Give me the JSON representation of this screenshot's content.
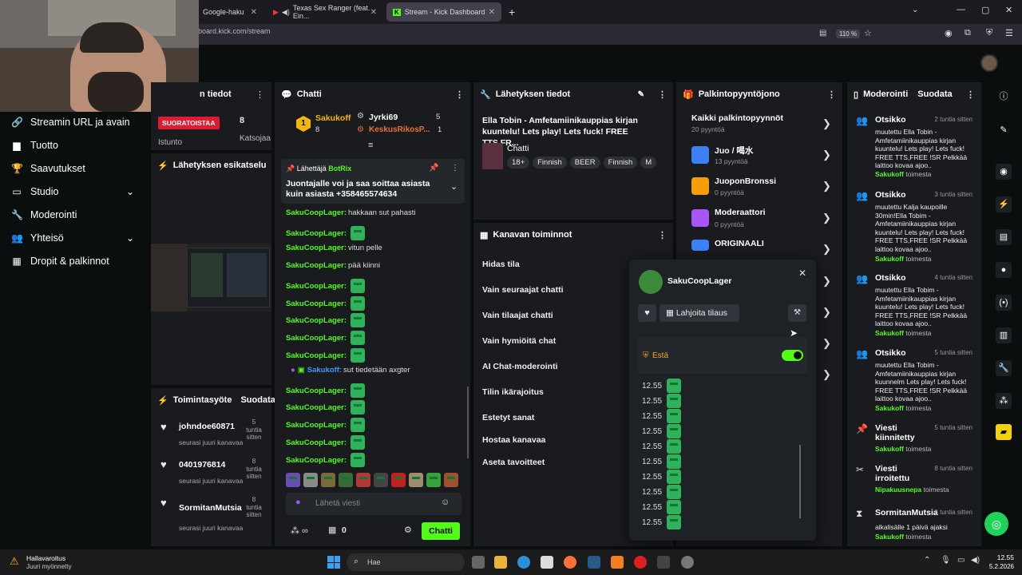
{
  "browser": {
    "tabs": [
      {
        "label": "Google-haku"
      },
      {
        "label": "Texas Sex Ranger (feat. Ein..."
      },
      {
        "label": "Stream - Kick Dashboard"
      }
    ],
    "url": "board.kick.com/stream",
    "zoom": "110 %"
  },
  "sidebar": {
    "items": [
      {
        "label": "Streamin URL ja avain",
        "icon": "link-icon"
      },
      {
        "label": "Tuotto",
        "icon": "money-icon"
      },
      {
        "label": "Saavutukset",
        "icon": "trophy-icon"
      },
      {
        "label": "Studio",
        "icon": "studio-icon"
      },
      {
        "label": "Moderointi",
        "icon": "wrench-icon"
      },
      {
        "label": "Yhteisö",
        "icon": "community-icon"
      },
      {
        "label": "Dropit & palkinnot",
        "icon": "gift-icon"
      }
    ]
  },
  "stream_info": {
    "title": "n tiedot",
    "live_badge": "SUORATOISTAA",
    "viewers": "8",
    "session_label": "Istunto",
    "viewers_label": "Katsojaa"
  },
  "preview": {
    "title": "Lähetyksen esikatselu"
  },
  "activity": {
    "title": "Toimintasyöte",
    "filter": "Suodata",
    "items": [
      {
        "name": "johndoe60871",
        "time": "5 tuntia sitten",
        "action": "seurasi juuri kanavaa"
      },
      {
        "name": "0401976814",
        "time": "8 tuntia sitten",
        "action": "seurasi juuri kanavaa"
      },
      {
        "name": "SormitanMutsia",
        "time": "8 tuntia sitten",
        "action": "seurasi juuri kanavaa"
      }
    ]
  },
  "chat": {
    "title": "Chatti",
    "leader1": {
      "name": "Sakukoff",
      "count": "8",
      "rank": "1"
    },
    "leader2": {
      "name": "Jyrki69",
      "count": "5"
    },
    "leader3": {
      "name": "KeskusRikosP...",
      "count": "1"
    },
    "pinned": {
      "by_label": "Lähettäjä",
      "by": "BotRix",
      "text": "Juontajalle voi ja saa soittaa asiasta kuin asiasta +358465574634"
    },
    "messages": [
      {
        "user": "SakuCoopLager:",
        "text": "hakkaan sut pahasti"
      },
      {
        "user": "SakuCoopLager:",
        "text": ""
      },
      {
        "user": "SakuCoopLager:",
        "text": "vitun pelle"
      },
      {
        "user": "SakuCoopLager:",
        "text": "pää kiinni"
      },
      {
        "user": "SakuCoopLager:",
        "text": ""
      },
      {
        "user": "SakuCoopLager:",
        "text": ""
      },
      {
        "user": "SakuCoopLager:",
        "text": ""
      },
      {
        "user": "SakuCoopLager:",
        "text": ""
      },
      {
        "user": "SakuCoopLager:",
        "text": ""
      },
      {
        "user": "Sakukoff:",
        "text": "sut tiedetään axgter"
      },
      {
        "user": "SakuCoopLager:",
        "text": ""
      },
      {
        "user": "SakuCoopLager:",
        "text": ""
      },
      {
        "user": "SakuCoopLager:",
        "text": ""
      },
      {
        "user": "SakuCoopLager:",
        "text": ""
      },
      {
        "user": "SakuCoopLager:",
        "text": ""
      }
    ],
    "input_placeholder": "Lähetä viesti",
    "points": "0",
    "send_label": "Chatti"
  },
  "broadcast": {
    "title": "Lähetyksen tiedot",
    "stream_title": "Ella Tobin - Amfetamiinikauppias kirjan kuuntelu! Lets play! Lets fuck! FREE TTS,FR...",
    "category": "Chatti",
    "tags": [
      "18+",
      "Finnish",
      "BEER",
      "Finnish",
      "M"
    ]
  },
  "channel_actions": {
    "title": "Kanavan toiminnot",
    "items": [
      "Hidas tila",
      "Vain seuraajat chatti",
      "Vain tilaajat chatti",
      "Vain hymiöitä chat",
      "AI Chat-moderointi",
      "Tilin ikärajoitus",
      "Estetyt sanat",
      "Hostaa kanavaa",
      "Aseta tavoitteet"
    ]
  },
  "rewards": {
    "title": "Palkintopyyntöjono",
    "all": {
      "label": "Kaikki palkintopyynnöt",
      "count": "20 pyyntöä"
    },
    "items": [
      {
        "name": "Juo / 喝水",
        "count": "13 pyyntöä",
        "color": "#3b82f6"
      },
      {
        "name": "JuoponBronssi",
        "count": "0 pyyntöä",
        "color": "#f59e0b"
      },
      {
        "name": "Moderaattori",
        "count": "0 pyyntöä",
        "color": "#a855f7"
      },
      {
        "name": "ORIGINAALI",
        "count": "",
        "color": "#3b82f6"
      }
    ]
  },
  "popup": {
    "username": "SakuCoopLager",
    "gift_label": "Lahjoita tilaus",
    "ban_label": "Estä",
    "log": [
      "12.55",
      "12.55",
      "12.55",
      "12.55",
      "12.55",
      "12.55",
      "12.55",
      "12.55",
      "12.55",
      "12.55"
    ]
  },
  "moderation": {
    "title": "Moderointi",
    "filter": "Suodata",
    "items": [
      {
        "title": "Otsikko",
        "time": "2 tuntia sitten",
        "body": "muutettu Ella Tobin - Amfetamiinikauppias kirjan kuuntelu! Lets play! Lets fuck! FREE TTS,FREE !SR Pelkkää laittoo kovaa ajoo..",
        "by": "Sakukoff",
        "by_suffix": "toimesta"
      },
      {
        "title": "Otsikko",
        "time": "3 tuntia sitten",
        "body": "muutettu Kalja kaupoille 30min!Ella Tobim - Amfetamiinikauppias kirjan kuuntelu! Lets play! Lets fuck! FREE TTS,FREE !SR Pelkkää laittoo kovaa ajoo..",
        "by": "Sakukoff",
        "by_suffix": "toimesta"
      },
      {
        "title": "Otsikko",
        "time": "4 tuntia sitten",
        "body": "muutettu Ella Tobim - Amfetamiinikauppias kirjan kuuntelu! Lets play! Lets fuck! FREE TTS,FREE !SR Pelkkää laittoo kovaa ajoo..",
        "by": "Sakukoff",
        "by_suffix": "toimesta"
      },
      {
        "title": "Otsikko",
        "time": "5 tuntia sitten",
        "body": "muutettu Ella Tobim - Amfetamiinikauppias kirjan kuunnelm Lets play! Lets fuck! FREE TTS,FREE !SR Pelkkää laittoo kovaa ajoo..",
        "by": "Sakukoff",
        "by_suffix": "toimesta"
      },
      {
        "title": "Viesti kiinnitetty",
        "time": "5 tuntia sitten",
        "body": "",
        "by": "Sakukoff",
        "by_suffix": "toimesta"
      },
      {
        "title": "Viesti irroitettu",
        "time": "8 tuntia sitten",
        "body": "",
        "by": "Nipakuusnepa",
        "by_suffix": "toimesta"
      },
      {
        "title": "SormitanMutsia",
        "time": "8 tuntia sitten",
        "body": "alkalisälle 1 päivä ajaksi",
        "by": "Sakukoff",
        "by_suffix": "toimesta"
      }
    ]
  },
  "taskbar": {
    "weather_title": "Hallavaroitus",
    "weather_sub": "Juuri myönnetty",
    "search": "Hae",
    "time": "12.55",
    "date": "5.2.2026"
  }
}
